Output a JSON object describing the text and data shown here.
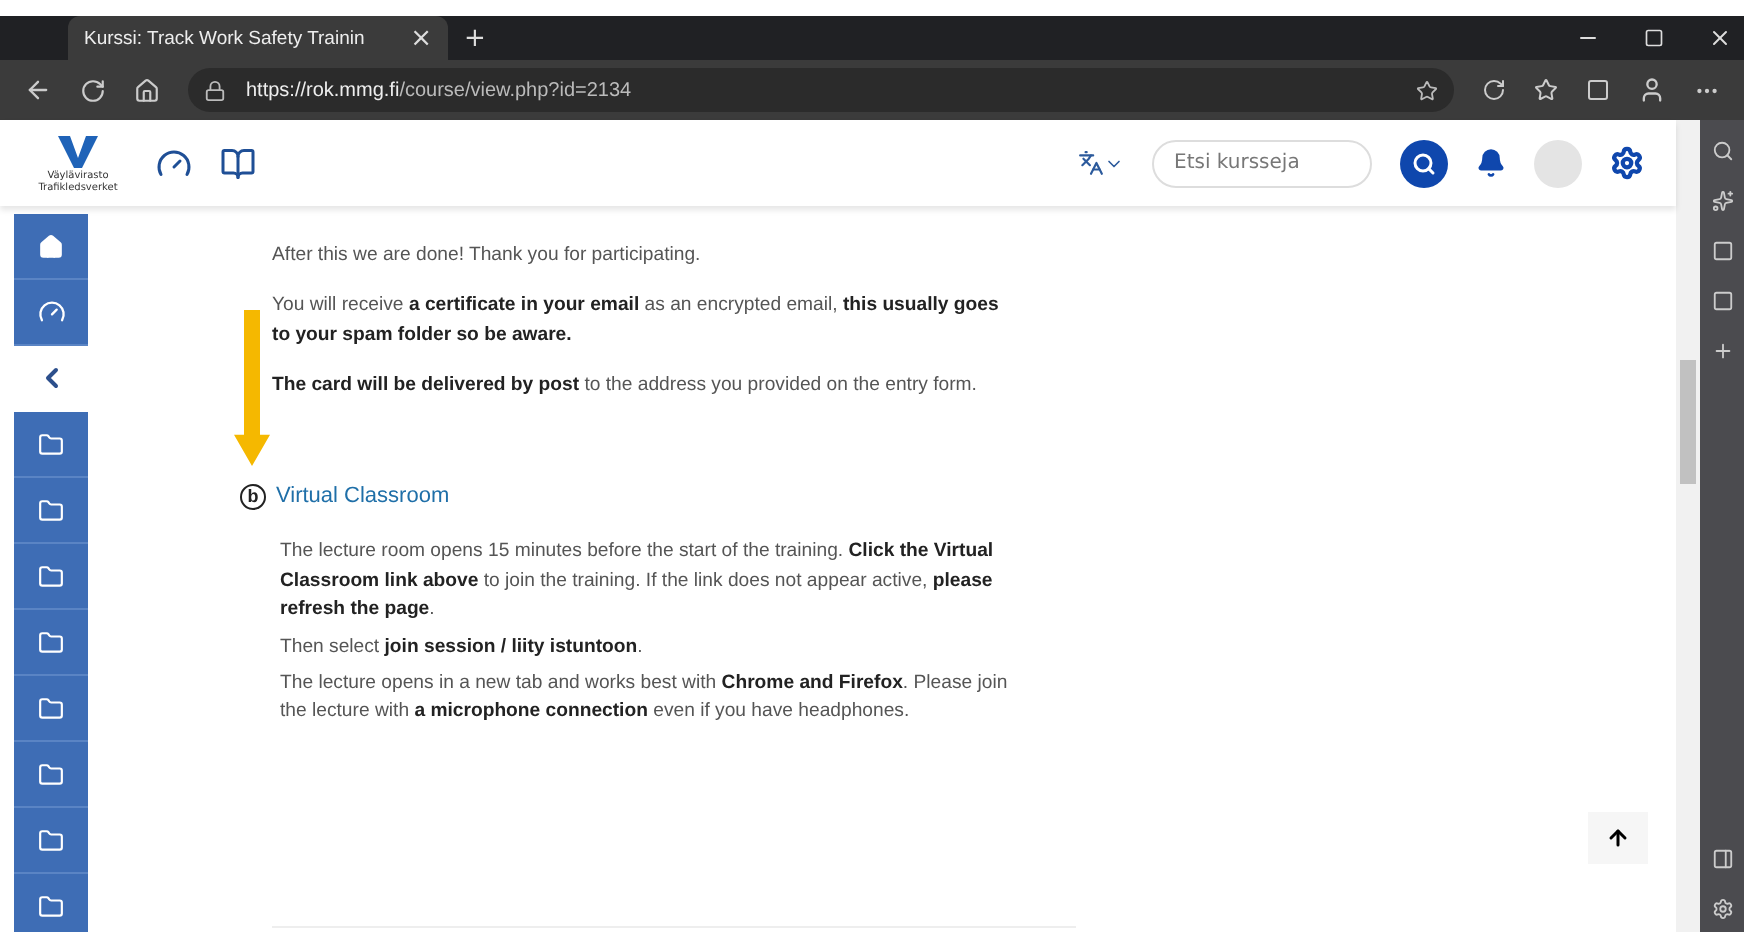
{
  "browser": {
    "tab_title": "Kurssi: Track Work Safety Trainin",
    "tab_close": "×",
    "new_tab": "+",
    "url_host": "https://rok.mmg.fi",
    "url_path": "/course/view.php?id=2134"
  },
  "header": {
    "logo_text": "Väylävirasto Trafikledsverket",
    "search": {
      "placeholder": "Etsi kursseja"
    }
  },
  "sidebar": {
    "items": [
      {
        "kind": "home",
        "selected": false
      },
      {
        "kind": "dashboard",
        "selected": false
      },
      {
        "kind": "collapse",
        "selected": true
      },
      {
        "kind": "folder",
        "selected": false
      },
      {
        "kind": "folder",
        "selected": false
      },
      {
        "kind": "folder",
        "selected": false
      },
      {
        "kind": "folder",
        "selected": false
      },
      {
        "kind": "folder",
        "selected": false
      },
      {
        "kind": "folder",
        "selected": false
      },
      {
        "kind": "folder",
        "selected": false
      },
      {
        "kind": "folder",
        "selected": false
      }
    ]
  },
  "content": {
    "top_paragraphs": [
      "After this we are done! Thank you for participating.",
      "You will receive **a certificate in your email** as an encrypted email, **this usually goes to your spam folder so be aware.**",
      "**The card will be delivered by post** to the address you provided on the entry form."
    ],
    "activity": {
      "badge": "b",
      "link": "Virtual Classroom"
    },
    "activity_paragraphs": [
      "The lecture room opens 15 minutes before the start of the training. **Click the Virtual Classroom link above** to join the training. If the link does not appear active, **please refresh the page**.",
      "Then select **join session / liity istuntoon**.",
      "The lecture opens in a new tab and works best with **Chrome and Firefox**. Please join the lecture with **a microphone connection** even if you have headphones."
    ]
  }
}
